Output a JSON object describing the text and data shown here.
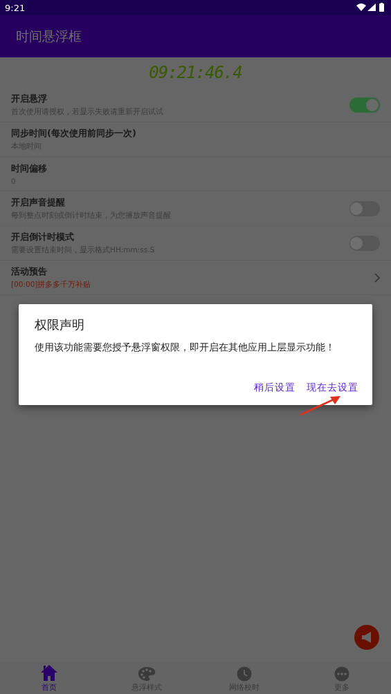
{
  "status_bar": {
    "time": "9:21"
  },
  "app_bar": {
    "title": "时间悬浮框"
  },
  "clock": "09:21:46.4",
  "settings": [
    {
      "kind": "toggle",
      "title": "开启悬浮",
      "subtitle": "首次使用请授权，若显示失败请重新开启试试",
      "on": true
    },
    {
      "kind": "info",
      "title": "同步时间(每次使用前同步一次)",
      "subtitle": "本地时间"
    },
    {
      "kind": "info",
      "title": "时间偏移",
      "subtitle": "0"
    },
    {
      "kind": "toggle",
      "title": "开启声音提醒",
      "subtitle": "每到整点时刻或倒计时结束，为您播放声音提醒",
      "on": false
    },
    {
      "kind": "toggle",
      "title": "开启倒计时模式",
      "subtitle": "需要设置结束时间，显示格式HH:mm:ss.S",
      "on": false
    },
    {
      "kind": "promo",
      "title": "活动预告",
      "subtitle": "[00:00]拼多多千万补贴"
    }
  ],
  "dialog": {
    "title": "权限声明",
    "message": "使用该功能需要您授予悬浮窗权限，即开启在其他应用上层显示功能！",
    "buttons": [
      "稍后设置",
      "现在去设置"
    ]
  },
  "bottom_nav": [
    {
      "label": "首页",
      "selected": true
    },
    {
      "label": "悬浮样式",
      "selected": false
    },
    {
      "label": "网络校时",
      "selected": false
    },
    {
      "label": "更多",
      "selected": false
    }
  ]
}
